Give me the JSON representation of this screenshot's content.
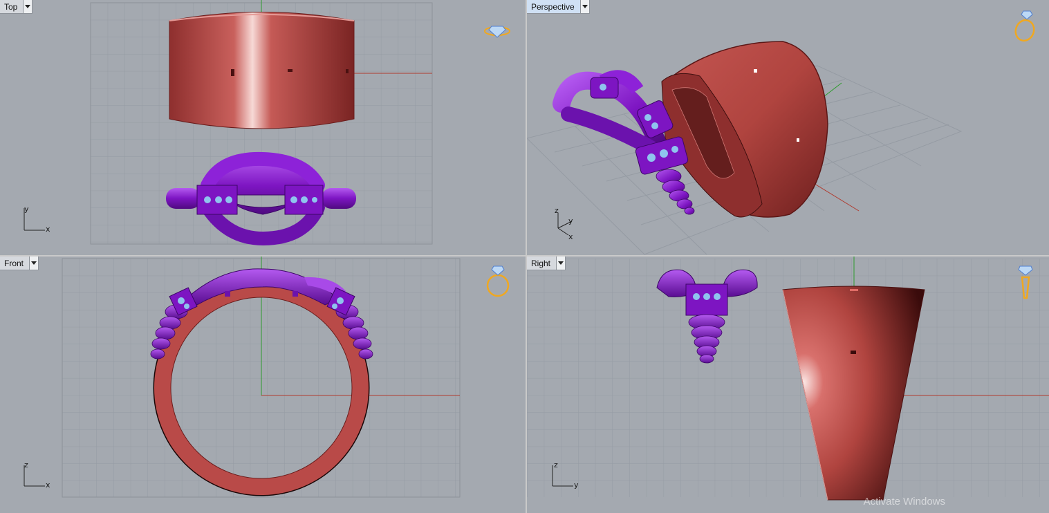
{
  "viewports": {
    "top": {
      "label": "Top",
      "axis_h": "x",
      "axis_v": "y"
    },
    "perspective": {
      "label": "Perspective",
      "axis_x": "x",
      "axis_y": "y",
      "axis_z": "z"
    },
    "front": {
      "label": "Front",
      "axis_h": "x",
      "axis_v": "z"
    },
    "right": {
      "label": "Right",
      "axis_h": "y",
      "axis_v": "z"
    }
  },
  "watermark": "Activate Windows",
  "colors": {
    "viewport_bg": "#a4a9b0",
    "grid": "#9097a0",
    "ring_band": "#b94a48",
    "ring_accent": "#8a1fd1",
    "gems": "#8fc4ee",
    "axis_x": "#b03a2e",
    "axis_y": "#2e9b2e",
    "viewport_icon": "#f0a820"
  }
}
